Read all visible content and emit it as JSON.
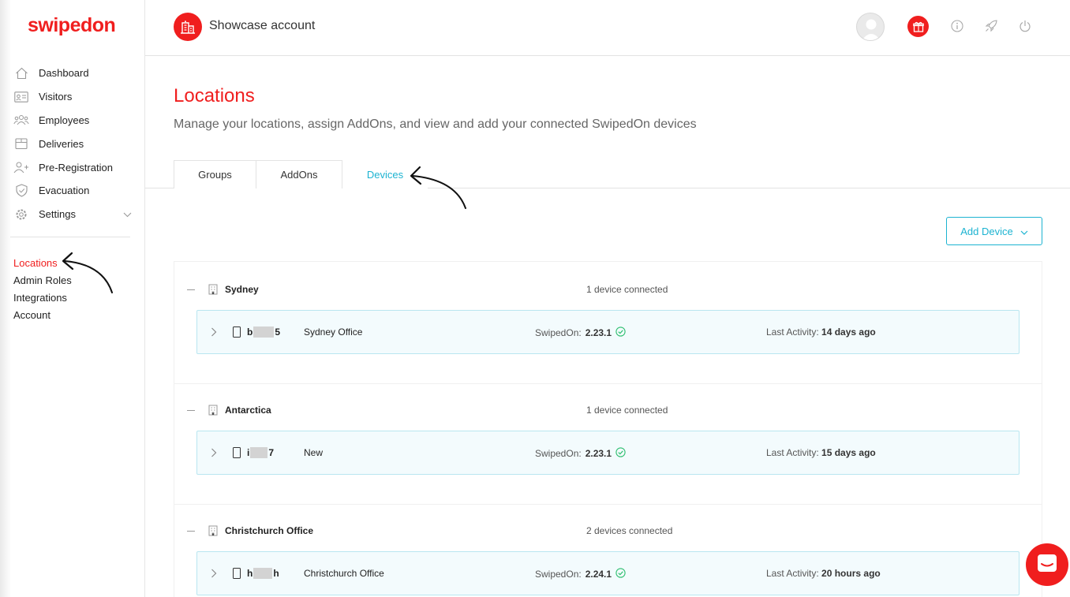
{
  "brand": {
    "logo": "swipedon",
    "accent": "#f01e1e",
    "link_color": "#1cb3d1"
  },
  "sidebar": {
    "items": [
      {
        "label": "Dashboard",
        "icon": "home-icon"
      },
      {
        "label": "Visitors",
        "icon": "id-card-icon"
      },
      {
        "label": "Employees",
        "icon": "people-icon"
      },
      {
        "label": "Deliveries",
        "icon": "box-icon"
      },
      {
        "label": "Pre-Registration",
        "icon": "add-person-icon"
      },
      {
        "label": "Evacuation",
        "icon": "shield-icon"
      },
      {
        "label": "Settings",
        "icon": "gear-icon"
      }
    ],
    "sub_items": [
      {
        "label": "Locations",
        "active": true
      },
      {
        "label": "Admin Roles"
      },
      {
        "label": "Integrations"
      },
      {
        "label": "Account"
      }
    ]
  },
  "header": {
    "account_name": "Showcase account"
  },
  "page": {
    "title": "Locations",
    "subtitle": "Manage your locations, assign AddOns, and view and add your connected SwipedOn devices"
  },
  "tabs": [
    {
      "label": "Groups"
    },
    {
      "label": "AddOns"
    },
    {
      "label": "Devices",
      "active": true
    }
  ],
  "add_device": {
    "label": "Add Device"
  },
  "groups": [
    {
      "name": "Sydney",
      "count": "1 device connected",
      "devices": [
        {
          "id_start": "b",
          "id_end": "5",
          "name": "Sydney Office",
          "version_label": "SwipedOn:",
          "version": "2.23.1",
          "activity_label": "Last Activity:",
          "activity": "14 days ago"
        }
      ]
    },
    {
      "name": "Antarctica",
      "count": "1 device connected",
      "devices": [
        {
          "id_start": "i",
          "id_end": "7",
          "name": "New",
          "version_label": "SwipedOn:",
          "version": "2.23.1",
          "activity_label": "Last Activity:",
          "activity": "15 days ago"
        }
      ]
    },
    {
      "name": "Christchurch Office",
      "count": "2 devices connected",
      "devices": [
        {
          "id_start": "h",
          "id_end": "h",
          "name": "Christchurch Office",
          "version_label": "SwipedOn:",
          "version": "2.24.1",
          "activity_label": "Last Activity:",
          "activity": "20 hours ago"
        }
      ]
    }
  ]
}
